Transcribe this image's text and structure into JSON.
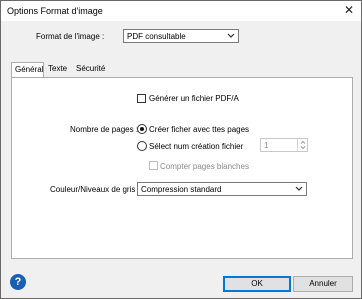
{
  "window": {
    "title": "Options Format d'image",
    "close_glyph": "✕"
  },
  "format": {
    "label": "Format de l'image :",
    "value": "PDF consultable"
  },
  "tabs": [
    {
      "label": "Général",
      "active": true
    },
    {
      "label": "Texte",
      "active": false
    },
    {
      "label": "Sécurité",
      "active": false
    }
  ],
  "general": {
    "generate_pdfa_label": "Générer un fichier PDF/A",
    "pages_label": "Nombre de pages :",
    "radio_all_pages_label": "Créer ficher avec ttes pages",
    "radio_select_label": "Sélect num création fichier",
    "spin_value": "1",
    "count_blank_label": "Compter pages blanches",
    "color_label": "Couleur/Niveaux de gris :",
    "color_value": "Compression standard"
  },
  "buttons": {
    "ok": "OK",
    "cancel": "Annuler",
    "help_glyph": "?"
  },
  "colors": {
    "accent": "#0078d7",
    "help": "#1a5fb4"
  }
}
